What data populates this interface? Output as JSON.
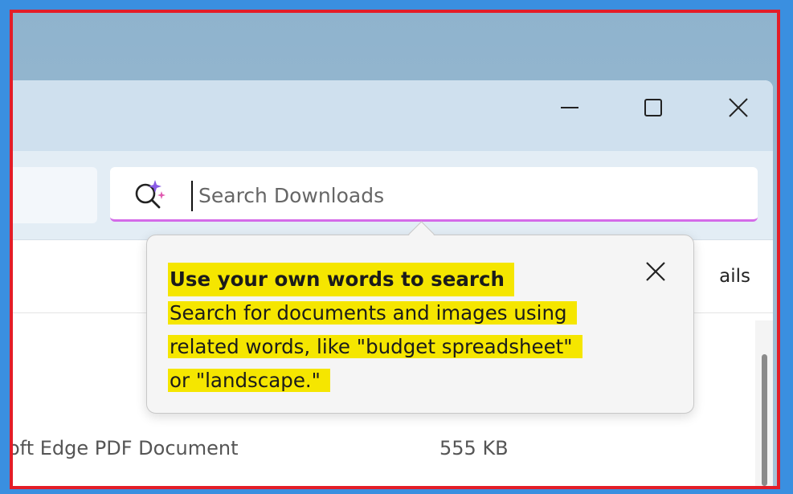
{
  "window": {
    "controls": {
      "minimize_icon": "minimize-icon",
      "maximize_icon": "maximize-icon",
      "close_icon": "close-icon"
    }
  },
  "search": {
    "placeholder": "Search Downloads",
    "value": "",
    "icon": "ai-search-sparkle-icon",
    "accent_color": "#d46be8"
  },
  "list": {
    "header_partial": "ails",
    "rows": [
      {
        "type": "oft Edge PDF Document",
        "size": "555 KB"
      }
    ]
  },
  "teaching_tip": {
    "title": "Use your own words to search",
    "body_lines": [
      "Search for documents and images using",
      "related words, like \"budget spreadsheet\"",
      "or \"landscape.\""
    ],
    "close_icon": "close-icon",
    "highlight_color": "#f5e600"
  },
  "frame": {
    "background_color": "#3a8fe0",
    "border_color": "#e31d28"
  }
}
